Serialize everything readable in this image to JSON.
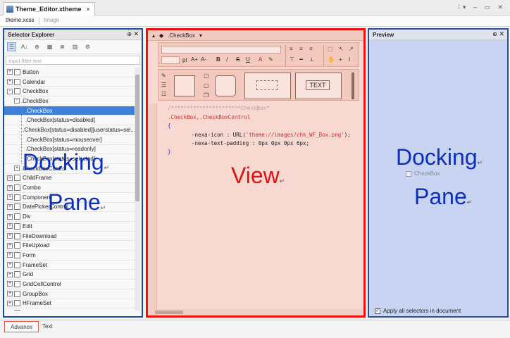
{
  "document_tab": {
    "title": "Theme_Editor.xtheme",
    "close": "×"
  },
  "window_controls": "⁞▾ – ▭ ✕",
  "sub_tabs": {
    "active": "theme.xcss",
    "inactive": "Image"
  },
  "left_pane": {
    "title": "Selector Explorer",
    "pin": "⊕",
    "close": "✕",
    "filter_placeholder": "Input filter text",
    "tree": [
      {
        "label": "Button",
        "level": 0,
        "expand": "+"
      },
      {
        "label": "Calendar",
        "level": 0,
        "expand": "+"
      },
      {
        "label": "CheckBox",
        "level": 0,
        "expand": "-"
      },
      {
        "label": ".CheckBox",
        "level": 1,
        "expand": "-"
      },
      {
        "label": ".CheckBox",
        "level": 2,
        "selected": true
      },
      {
        "label": ".CheckBox[status=disabled]",
        "level": 2
      },
      {
        "label": ".CheckBox[status=disabled][userstatus=sel...",
        "level": 2
      },
      {
        "label": ".CheckBox[status=mouseover]",
        "level": 2
      },
      {
        "label": ".CheckBox[status=readonly]",
        "level": 2
      },
      {
        "label": ".CheckBox[status=selected]",
        "level": 2
      },
      {
        "label": ".CheckBoxControl",
        "level": 1,
        "expand": "+"
      },
      {
        "label": "ChildFrame",
        "level": 0,
        "expand": "+"
      },
      {
        "label": "Combo",
        "level": 0,
        "expand": "+"
      },
      {
        "label": "Component",
        "level": 0,
        "expand": "+"
      },
      {
        "label": "DatePickerControl",
        "level": 0,
        "expand": "+"
      },
      {
        "label": "Div",
        "level": 0,
        "expand": "+"
      },
      {
        "label": "Edit",
        "level": 0,
        "expand": "+"
      },
      {
        "label": "FileDownload",
        "level": 0,
        "expand": "+"
      },
      {
        "label": "FileUpload",
        "level": 0,
        "expand": "+"
      },
      {
        "label": "Form",
        "level": 0,
        "expand": "+"
      },
      {
        "label": "FrameSet",
        "level": 0,
        "expand": "+"
      },
      {
        "label": "Grid",
        "level": 0,
        "expand": "+"
      },
      {
        "label": "GridCellControl",
        "level": 0,
        "expand": "+"
      },
      {
        "label": "GroupBox",
        "level": 0,
        "expand": "+"
      },
      {
        "label": "HFrameSet",
        "level": 0,
        "expand": "+"
      },
      {
        "label": "ImageViewer",
        "level": 0,
        "expand": "+"
      }
    ],
    "overlay": {
      "line1": "Docking",
      "line2": "Pane",
      "ret": "↵"
    }
  },
  "center_pane": {
    "breadcrumb": ".CheckBox",
    "toolbar": {
      "font_size_unit": "pt",
      "grow_label": "A+",
      "shrink_label": "A-",
      "bold": "B",
      "italic": "I",
      "strike": "S",
      "underline": "U",
      "text_sample": "TEXT"
    },
    "code": {
      "comment": "/**********************CheckBox*",
      "selector": ".CheckBox,.CheckBoxControl",
      "open": "{",
      "prop1_name": "-nexa-icon : URL(",
      "prop1_value": "'theme://images/chk_WF_Box.png'",
      "prop1_end": ");",
      "prop2": "-nexa-text-padding : 0px 0px 0px 6px;",
      "close": "}"
    },
    "overlay": {
      "label": "View",
      "ret": "↵"
    }
  },
  "right_pane": {
    "title": "Preview",
    "pin": "⊕",
    "close": "✕",
    "overlay": {
      "line1": "Docking",
      "line2": "Pane",
      "ret": "↵"
    },
    "checkbox_label": "CheckBox",
    "apply_label": "Apply all selectors in document",
    "apply_checked": "✓"
  },
  "bottom_tabs": {
    "active": "Advance",
    "inactive": "Text"
  },
  "colors": {
    "left_border": "#1a4e9e",
    "center_border": "#e11111",
    "right_border": "#2a4f92",
    "label_blue": "#0a2fc0",
    "label_red": "#e40f0f"
  }
}
